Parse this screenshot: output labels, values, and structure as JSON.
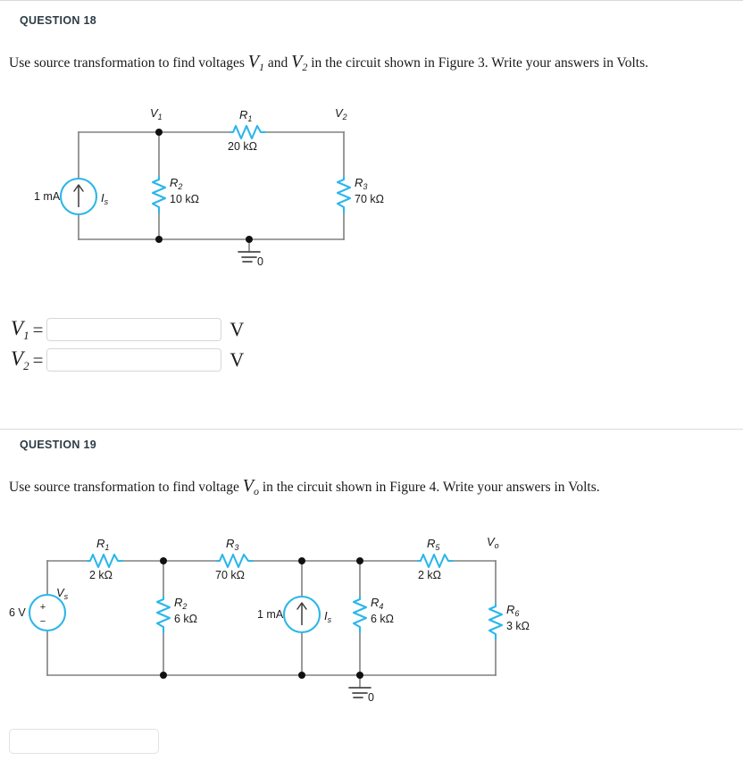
{
  "page": {
    "background": "#ffffff",
    "wire_color": "#808080",
    "component_color": "#2cb6ea",
    "node_color": "#000000",
    "text_color": "#1a1a1a",
    "heading_color": "#2d3b45"
  },
  "question18": {
    "heading": "QUESTION 18",
    "prompt_part1": "Use source transformation to find voltages",
    "prompt_var1": "V",
    "prompt_var1_sub": "1",
    "prompt_mid": "and",
    "prompt_var2": "V",
    "prompt_var2_sub": "2",
    "prompt_part2": "in the circuit shown in Figure 3. Write your answers in Volts.",
    "figure": {
      "name": "Figure 3",
      "source": {
        "label": "1 mA",
        "symbol": "I",
        "symbol_sub": "s",
        "type": "current-source",
        "direction": "up"
      },
      "nodes": [
        {
          "name": "V",
          "sub": "1"
        },
        {
          "name": "V",
          "sub": "2"
        }
      ],
      "ground_label": "0",
      "components": [
        {
          "ref": "R",
          "sub": "1",
          "value": "20 kΩ",
          "orientation": "horizontal"
        },
        {
          "ref": "R",
          "sub": "2",
          "value": "10 kΩ",
          "orientation": "vertical"
        },
        {
          "ref": "R",
          "sub": "3",
          "value": "70 kΩ",
          "orientation": "vertical"
        }
      ]
    },
    "answers": [
      {
        "label": "V",
        "sub": "1",
        "equals": "=",
        "value": "",
        "unit": "V"
      },
      {
        "label": "V",
        "sub": "2",
        "equals": "=",
        "value": "",
        "unit": "V"
      }
    ]
  },
  "question19": {
    "heading": "QUESTION 19",
    "prompt_part1": "Use source transformation to find voltage",
    "prompt_var": "V",
    "prompt_var_sub": "o",
    "prompt_part2": "in the circuit shown in Figure 4. Write your answers in Volts.",
    "figure": {
      "name": "Figure 4",
      "voltage_source": {
        "label": "6 V",
        "symbol": "V",
        "symbol_sub": "s",
        "plus": "+",
        "minus": "−"
      },
      "current_source": {
        "label": "1 mA",
        "symbol": "I",
        "symbol_sub": "s",
        "direction": "up"
      },
      "output_node": {
        "name": "V",
        "sub": "o"
      },
      "ground_label": "0",
      "components": [
        {
          "ref": "R",
          "sub": "1",
          "value": "2 kΩ",
          "orientation": "horizontal"
        },
        {
          "ref": "R",
          "sub": "2",
          "value": "6 kΩ",
          "orientation": "vertical"
        },
        {
          "ref": "R",
          "sub": "3",
          "value": "70 kΩ",
          "orientation": "horizontal"
        },
        {
          "ref": "R",
          "sub": "4",
          "value": "6 kΩ",
          "orientation": "vertical"
        },
        {
          "ref": "R",
          "sub": "5",
          "value": "2 kΩ",
          "orientation": "horizontal"
        },
        {
          "ref": "R",
          "sub": "6",
          "value": "3 kΩ",
          "orientation": "vertical"
        }
      ]
    },
    "answer": {
      "value": "",
      "placeholder": ""
    }
  }
}
